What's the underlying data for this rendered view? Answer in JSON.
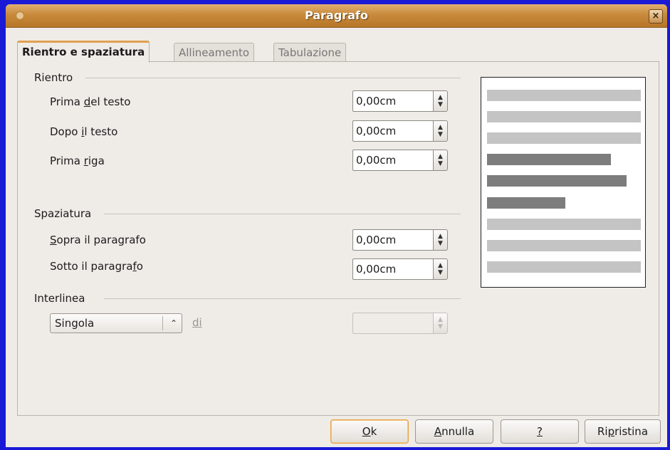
{
  "window": {
    "title": "Paragrafo",
    "close_glyph": "×"
  },
  "tabs": [
    {
      "label": "Rientro e spaziatura",
      "active": true
    },
    {
      "label": "Allineamento",
      "active": false
    },
    {
      "label": "Tabulazione",
      "active": false
    }
  ],
  "rientro": {
    "heading": "Rientro",
    "prima_del_testo": {
      "pre": "Prima ",
      "mn": "d",
      "post": "el testo",
      "value": "0,00cm"
    },
    "dopo_il_testo": {
      "pre": "Dopo ",
      "mn": "i",
      "post": "l testo",
      "value": "0,00cm"
    },
    "prima_riga": {
      "pre": "Prima ",
      "mn": "r",
      "post": "iga",
      "value": "0,00cm"
    }
  },
  "spaziatura": {
    "heading": "Spaziatura",
    "sopra": {
      "pre": "",
      "mn": "S",
      "post": "opra il paragrafo",
      "value": "0,00cm"
    },
    "sotto": {
      "pre": "Sotto il paragra",
      "mn": "f",
      "post": "o",
      "value": "0,00cm"
    }
  },
  "interlinea": {
    "heading": "Interlinea",
    "selected": "Singola",
    "di_label": "di",
    "di_value": ""
  },
  "buttons": {
    "ok": {
      "pre": "",
      "mn": "O",
      "post": "k"
    },
    "annulla": {
      "pre": "",
      "mn": "A",
      "post": "nnulla"
    },
    "help": {
      "pre": "",
      "mn": "?",
      "post": ""
    },
    "ripristina": {
      "pre": "Ri",
      "mn": "p",
      "post": "ristina"
    }
  },
  "icons": {
    "spin": "spin-arrows-icon",
    "combo": "combo-arrows-icon",
    "close": "close-icon"
  },
  "colors": {
    "titlebar": "#c88a3c",
    "desktop": "#1a1ad6",
    "dialog_bg": "#efebe7",
    "default_button_border": "#e8a040",
    "preview_light": "#c4c4c4",
    "preview_dark": "#7d7d7d"
  }
}
